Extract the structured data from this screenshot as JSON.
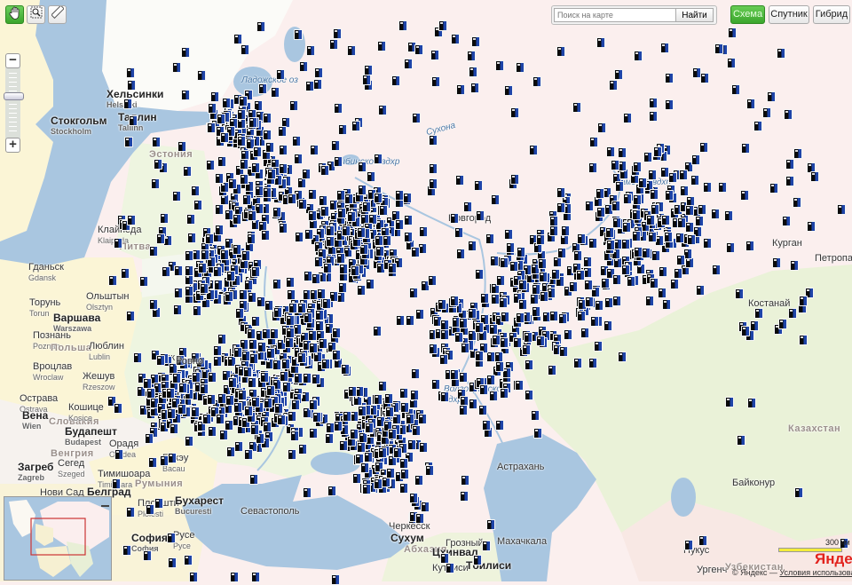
{
  "toolbar": {
    "icons": [
      "hand-drag-icon",
      "zoom-area-icon",
      "ruler-icon"
    ]
  },
  "zoom": {
    "minus": "−",
    "plus": "+",
    "level_fraction": 0.42
  },
  "search": {
    "placeholder": "Поиск на карте",
    "value": "",
    "button": "Найти"
  },
  "map_types": [
    {
      "label": "Схема",
      "active": true
    },
    {
      "label": "Спутник",
      "active": false
    },
    {
      "label": "Гибрид",
      "active": false
    }
  ],
  "labels": [
    {
      "name": "Хельсинки",
      "lat": "Helsinki"
    },
    {
      "name": "Стокгольм",
      "lat": "Stockholm"
    },
    {
      "name": "Таллин",
      "lat": "Tallinn"
    },
    {
      "name": "Эстония"
    },
    {
      "name": "Ладожское оз"
    },
    {
      "name": "Рыбинское вдхр"
    },
    {
      "name": "Сухона"
    },
    {
      "name": "Камское вдхр"
    },
    {
      "name": "Клайпеда",
      "lat": "Klaipeda"
    },
    {
      "name": "Литва"
    },
    {
      "name": "Гданьск",
      "lat": "Gdansk"
    },
    {
      "name": "Ольштын",
      "lat": "Olsztyn"
    },
    {
      "name": "Торунь",
      "lat": "Torun"
    },
    {
      "name": "Варшава",
      "lat": "Warszawa"
    },
    {
      "name": "Познань",
      "lat": "Poznan"
    },
    {
      "name": "Польша"
    },
    {
      "name": "Люблин",
      "lat": "Lublin"
    },
    {
      "name": "Вроцлав",
      "lat": "Wroclaw"
    },
    {
      "name": "Жешув",
      "lat": "Rzeszow"
    },
    {
      "name": "Луцк"
    },
    {
      "name": "Ровно"
    },
    {
      "name": "Острава",
      "lat": "Ostrava"
    },
    {
      "name": "Вена",
      "lat": "Wien"
    },
    {
      "name": "Словакия"
    },
    {
      "name": "Кошице",
      "lat": "Kosice"
    },
    {
      "name": "Будапешт",
      "lat": "Budapest"
    },
    {
      "name": "Венгрия"
    },
    {
      "name": "Орадя",
      "lat": "Oradea"
    },
    {
      "name": "Бакэу",
      "lat": "Bacau"
    },
    {
      "name": "Сегед",
      "lat": "Szeged"
    },
    {
      "name": "Загреб",
      "lat": "Zagreb"
    },
    {
      "name": "Тимишоара",
      "lat": "Timisoara"
    },
    {
      "name": "Нови Сад"
    },
    {
      "name": "Белград"
    },
    {
      "name": "Румыния"
    },
    {
      "name": "Плоешти",
      "lat": "Ploiesti"
    },
    {
      "name": "Бухарест",
      "lat": "Bucuresti"
    },
    {
      "name": "София",
      "lat": "София"
    },
    {
      "name": "Руcе",
      "lat": "Русе"
    },
    {
      "name": "Севастополь"
    },
    {
      "name": "Черкесск"
    },
    {
      "name": "Сухум"
    },
    {
      "name": "Абхазия"
    },
    {
      "name": "Грозный"
    },
    {
      "name": "Махачкала"
    },
    {
      "name": "Цхинвал"
    },
    {
      "name": "Кутаиси"
    },
    {
      "name": "Тбилиси"
    },
    {
      "name": "Волгоградское вдхр."
    },
    {
      "name": "Казахстан"
    },
    {
      "name": "Байконур"
    },
    {
      "name": "Нукус"
    },
    {
      "name": "Ургенч"
    },
    {
      "name": "Узбекистан"
    },
    {
      "name": "Костанай"
    },
    {
      "name": "Курган"
    },
    {
      "name": "Петропавл"
    },
    {
      "name": "Новгород"
    },
    {
      "name": "Астрахань"
    }
  ],
  "scale": {
    "label": "300 км"
  },
  "footer": {
    "logo": "Яндекс",
    "copyright": "© Яндекс —",
    "terms": "Условия использования"
  },
  "colors": {
    "sea": "#a9c6e0",
    "russia": "#fbefee",
    "green": "#eaf2d8",
    "yellow": "#fbf5d6",
    "marker_blue": "#1e44a8",
    "active_green": "#3ba62c"
  }
}
